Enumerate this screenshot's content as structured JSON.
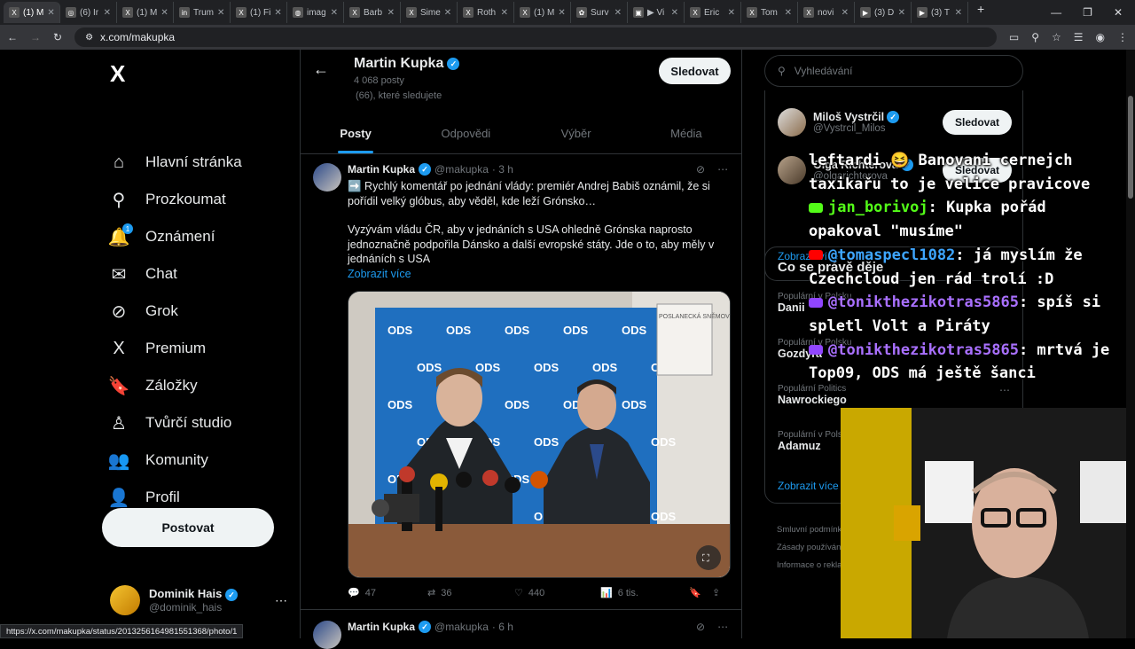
{
  "browser": {
    "tabs": [
      {
        "label": "(1) M",
        "fav": "X"
      },
      {
        "label": "(6) Ir",
        "fav": "◎"
      },
      {
        "label": "(1) M",
        "fav": "X"
      },
      {
        "label": "Trum",
        "fav": "in"
      },
      {
        "label": "(1) Fi",
        "fav": "X"
      },
      {
        "label": "imag",
        "fav": "◍"
      },
      {
        "label": "Barb",
        "fav": "X"
      },
      {
        "label": "Sime",
        "fav": "X"
      },
      {
        "label": "Roth",
        "fav": "X"
      },
      {
        "label": "(1) M",
        "fav": "X"
      },
      {
        "label": "Surv",
        "fav": "✿"
      },
      {
        "label": "▶ Vi",
        "fav": "▣"
      },
      {
        "label": "Eric",
        "fav": "X"
      },
      {
        "label": "Tom",
        "fav": "X"
      },
      {
        "label": "novi",
        "fav": "X"
      },
      {
        "label": "(3) D",
        "fav": "▶"
      },
      {
        "label": "(3) T",
        "fav": "▶"
      }
    ],
    "url": "x.com/makupka",
    "status_url": "https://x.com/makupka/status/2013256164981551368/photo/1"
  },
  "sidebar": {
    "logo": "X",
    "nav": [
      {
        "label": "Hlavní stránka",
        "icon": "home-icon",
        "glyph": "⌂"
      },
      {
        "label": "Prozkoumat",
        "icon": "search-icon",
        "glyph": "⚲"
      },
      {
        "label": "Oznámení",
        "icon": "bell-icon",
        "glyph": "🔔",
        "badge": "1"
      },
      {
        "label": "Chat",
        "icon": "mail-icon",
        "glyph": "✉"
      },
      {
        "label": "Grok",
        "icon": "grok-icon",
        "glyph": "⊘"
      },
      {
        "label": "Premium",
        "icon": "x-premium-icon",
        "glyph": "X"
      },
      {
        "label": "Záložky",
        "icon": "bookmark-icon",
        "glyph": "🔖"
      },
      {
        "label": "Tvůrčí studio",
        "icon": "creator-studio-icon",
        "glyph": "♙"
      },
      {
        "label": "Komunity",
        "icon": "communities-icon",
        "glyph": "👥"
      },
      {
        "label": "Profil",
        "icon": "profile-icon",
        "glyph": "👤"
      },
      {
        "label": "Víc",
        "icon": "more-icon",
        "glyph": "⋯"
      }
    ],
    "post_button": "Postovat",
    "account": {
      "name": "Dominik Hais",
      "handle": "@dominik_hais"
    }
  },
  "profile": {
    "name": "Martin Kupka",
    "posts_count": "4 068 posty",
    "follow_info": "(66), které sledujete",
    "follow_button": "Sledovat",
    "tabs": [
      "Posty",
      "Odpovědi",
      "Výběr",
      "Média"
    ]
  },
  "tweet": {
    "name": "Martin Kupka",
    "handle": "@makupka",
    "time": "· 3 h",
    "text_1": "➡️ Rychlý komentář po jednání vlády: premiér Andrej Babiš oznámil, že si pořídil velký glóbus, aby věděl, kde leží Grónsko…",
    "text_2": "Vyzývám vládu ČR, aby v jednáních s USA ohledně Grónska naprosto jednoznačně podpořila Dánsko a další evropské státy. Jde o to, aby měly v jednáních s USA",
    "show_more": "Zobrazit více",
    "media": {
      "banner_text": "ODS",
      "wall_sign": "POSLANECKÁ SNĚMOVNA PARLAMENTU ČESKÉ REPUBLIKY"
    },
    "actions": {
      "replies": "47",
      "reposts": "36",
      "likes": "440",
      "views": "6 tis."
    }
  },
  "tweet2": {
    "name": "Martin Kupka",
    "handle": "@makupka",
    "time": "· 6 h"
  },
  "right": {
    "search_placeholder": "Vyhledávání",
    "who_to_follow": [
      {
        "name": "Miloš Vystrčil",
        "handle": "@Vystrcil_Milos",
        "button": "Sledovat"
      },
      {
        "name": "Olga Richterová",
        "handle": "@olgarichterova",
        "button": "Sledovat"
      }
    ],
    "show_more": "Zobrazit více",
    "trends_title": "Co se právě děje",
    "trends": [
      {
        "category": "Populární v Polsku",
        "name": "Danii"
      },
      {
        "category": "Populární v Polsku",
        "name": "Gozdyra"
      },
      {
        "category": "Populární Politics",
        "name": "Nawrockiego"
      },
      {
        "category": "Populární v Polsku",
        "name": "Adamuz"
      }
    ],
    "trends_more": "Zobrazit více",
    "footer": [
      "Smluvní podmínky",
      "Zásady používání",
      "Informace o reklamách"
    ]
  },
  "stream_chat": [
    {
      "platform": "none",
      "user": "",
      "text": "leftardi 😆 Banovani cernejch"
    },
    {
      "platform": "none",
      "user": "",
      "text": "taxikařu to je velice pravicove"
    },
    {
      "platform": "kick",
      "user": "jan_borivoj",
      "text": ": Kupka pořád"
    },
    {
      "platform": "none",
      "user": "",
      "text": "opakoval \"musíme\""
    },
    {
      "platform": "youtube",
      "user": "@tomaspecl1082",
      "text": ": já myslím že"
    },
    {
      "platform": "none",
      "user": "",
      "text": "Czechcloud jen rád trolí :D"
    },
    {
      "platform": "twitch",
      "user": "@tonikthezikotras5865",
      "text": ": spíš si"
    },
    {
      "platform": "none",
      "user": "",
      "text": "spletl Volt a Piráty"
    },
    {
      "platform": "twitch",
      "user": "@tonikthezikotras5865",
      "text": ": mrtvá je"
    },
    {
      "platform": "none",
      "user": "",
      "text": "Top09, ODS má ještě šanci"
    }
  ],
  "colors": {
    "accent": "#1d9bf0",
    "bg": "#000000",
    "border": "#2f3336",
    "muted": "#71767b",
    "ods_blue": "#1f6fbf"
  }
}
